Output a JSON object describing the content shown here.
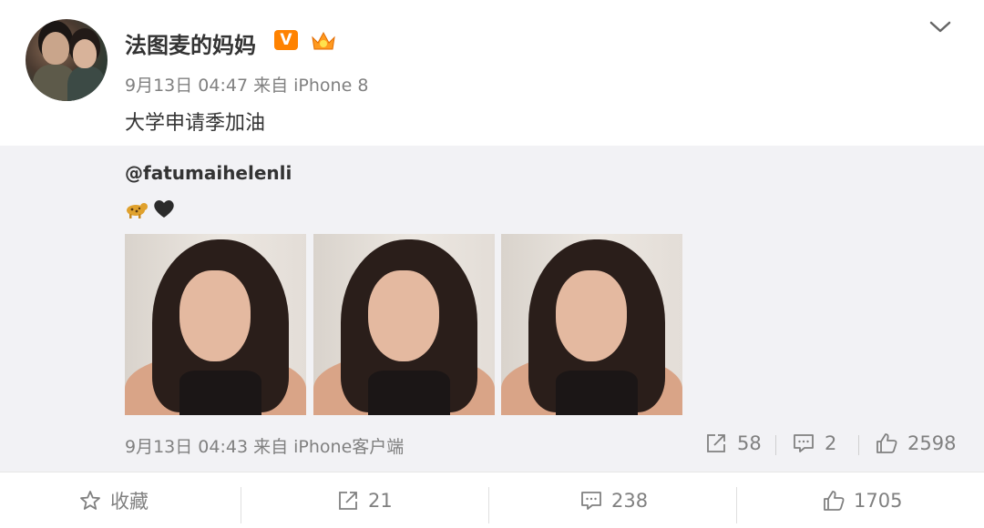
{
  "post": {
    "username": "法图麦的妈妈",
    "verified_badge": "V",
    "meta": "9月13日 04:47 来自 iPhone 8",
    "text": "大学申请季加油",
    "colors": {
      "badge": "#ff8200",
      "meta_text": "#808080"
    }
  },
  "repost": {
    "mention": "@fatumaihelenli",
    "emojis": [
      "leopard-emoji",
      "black-heart-emoji"
    ],
    "photos": [
      "photo-1",
      "photo-2",
      "photo-3"
    ],
    "meta": "9月13日 04:43 来自 iPhone客户端",
    "stats": {
      "shares": "58",
      "comments": "2",
      "likes": "2598"
    }
  },
  "actions": {
    "favorite_label": "收藏",
    "forward_count": "21",
    "comment_count": "238",
    "like_count": "1705"
  }
}
